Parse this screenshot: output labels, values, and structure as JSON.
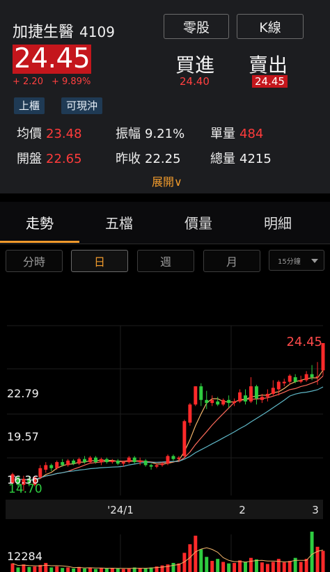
{
  "stock": {
    "name": "加捷生醫",
    "code": "4109",
    "price": "24.45",
    "change": "+ 2.20",
    "change_pct": "+ 9.89%",
    "tags": [
      "上櫃",
      "可現沖"
    ]
  },
  "top_buttons": {
    "odd_lot": "零股",
    "kline": "K線"
  },
  "quote": {
    "buy_label": "買進",
    "buy_value": "24.40",
    "sell_label": "賣出",
    "sell_value": "24.45"
  },
  "stats": {
    "avg_label": "均價",
    "avg_value": "23.48",
    "amp_label": "振幅",
    "amp_value": "9.21%",
    "unit_vol_label": "單量",
    "unit_vol_value": "484",
    "open_label": "開盤",
    "open_value": "22.65",
    "prev_close_label": "昨收",
    "prev_close_value": "22.25",
    "total_vol_label": "總量",
    "total_vol_value": "4215"
  },
  "expand_label": "展開∨",
  "tabs": [
    "走勢",
    "五檔",
    "價量",
    "明細"
  ],
  "period_buttons": [
    "分時",
    "日",
    "週",
    "月"
  ],
  "interval_select": "15分鐘",
  "colors": {
    "up": "#ff2a2a",
    "down": "#2ecc40",
    "accent": "#f09a2c",
    "ma_orange": "#f3b46a",
    "ma_red": "#ff6b5b",
    "ma_cyan": "#5fb8c8"
  },
  "chart_data": {
    "type": "candlestick",
    "price_axis_labels": [
      "22.79",
      "19.57",
      "16.36"
    ],
    "max_label": "24.45",
    "min_label": "14.70",
    "x_tick_labels": [
      "'24/1",
      "2",
      "3"
    ],
    "volume_label": "12284",
    "ylim": [
      14.4,
      25.6
    ],
    "candles": [
      [
        15.2,
        15.8,
        15.0,
        15.9
      ],
      [
        15.6,
        15.1,
        14.9,
        15.7
      ],
      [
        15.1,
        15.5,
        14.7,
        15.7
      ],
      [
        15.5,
        15.2,
        15.0,
        15.7
      ],
      [
        15.1,
        15.6,
        15.0,
        15.7
      ],
      [
        15.6,
        16.2,
        15.5,
        16.4
      ],
      [
        16.1,
        16.4,
        15.9,
        16.6
      ],
      [
        16.4,
        16.2,
        16.0,
        16.5
      ],
      [
        16.2,
        16.6,
        16.1,
        16.7
      ],
      [
        16.6,
        16.4,
        16.3,
        16.8
      ],
      [
        16.4,
        16.7,
        16.3,
        16.8
      ],
      [
        16.7,
        16.5,
        16.4,
        16.8
      ],
      [
        16.5,
        16.8,
        16.4,
        16.9
      ],
      [
        16.8,
        16.6,
        16.5,
        17.0
      ],
      [
        16.6,
        16.9,
        16.5,
        17.0
      ],
      [
        16.9,
        16.6,
        16.5,
        17.0
      ],
      [
        16.6,
        16.8,
        16.4,
        16.9
      ],
      [
        16.8,
        16.6,
        16.5,
        16.9
      ],
      [
        16.6,
        16.7,
        16.5,
        16.8
      ],
      [
        16.7,
        16.5,
        16.4,
        16.8
      ],
      [
        16.5,
        16.6,
        16.3,
        16.7
      ],
      [
        16.6,
        16.9,
        16.5,
        17.0
      ],
      [
        16.9,
        16.6,
        16.5,
        17.0
      ],
      [
        16.6,
        16.7,
        16.4,
        16.9
      ],
      [
        16.7,
        16.4,
        16.3,
        16.8
      ],
      [
        16.4,
        16.3,
        16.1,
        16.5
      ],
      [
        16.3,
        16.4,
        16.2,
        16.5
      ],
      [
        16.4,
        16.5,
        16.3,
        16.6
      ],
      [
        16.5,
        17.0,
        16.4,
        17.1
      ],
      [
        17.0,
        16.8,
        16.7,
        17.1
      ],
      [
        16.8,
        16.9,
        16.6,
        17.0
      ],
      [
        17.0,
        19.3,
        16.9,
        19.4
      ],
      [
        19.2,
        20.4,
        19.0,
        20.5
      ],
      [
        20.4,
        21.6,
        20.3,
        21.6
      ],
      [
        21.6,
        20.7,
        20.3,
        21.8
      ],
      [
        20.7,
        20.5,
        20.1,
        21.3
      ],
      [
        20.5,
        20.7,
        20.3,
        21.0
      ],
      [
        20.6,
        20.4,
        20.3,
        20.9
      ],
      [
        20.4,
        20.7,
        20.3,
        20.8
      ],
      [
        20.7,
        20.5,
        20.2,
        21.0
      ],
      [
        20.5,
        20.6,
        20.3,
        20.8
      ],
      [
        20.6,
        21.2,
        20.5,
        21.4
      ],
      [
        21.0,
        20.6,
        20.4,
        21.4
      ],
      [
        20.6,
        21.6,
        20.5,
        22.2
      ],
      [
        21.6,
        20.8,
        20.4,
        21.7
      ],
      [
        20.7,
        20.9,
        20.5,
        21.1
      ],
      [
        20.9,
        21.1,
        20.6,
        21.4
      ],
      [
        21.1,
        21.5,
        21.0,
        22.0
      ],
      [
        21.4,
        21.9,
        21.0,
        22.0
      ],
      [
        21.8,
        21.9,
        21.6,
        22.1
      ],
      [
        21.9,
        22.3,
        21.7,
        22.4
      ],
      [
        22.2,
        21.9,
        21.8,
        22.4
      ],
      [
        21.9,
        22.0,
        21.8,
        22.3
      ],
      [
        22.0,
        22.4,
        21.9,
        22.6
      ],
      [
        22.4,
        22.2,
        22.0,
        23.0
      ],
      [
        22.2,
        22.25,
        21.7,
        23.2
      ],
      [
        22.65,
        24.45,
        22.3,
        24.45
      ]
    ],
    "volume": [
      1700,
      900,
      1500,
      1000,
      1100,
      1400,
      1800,
      900,
      1100,
      800,
      900,
      700,
      1000,
      700,
      900,
      600,
      800,
      700,
      800,
      700,
      600,
      700,
      900,
      800,
      700,
      900,
      1100,
      1300,
      1500,
      1800,
      1700,
      3800,
      5500,
      7200,
      4500,
      3000,
      2200,
      2600,
      2000,
      1700,
      1800,
      2300,
      2000,
      2800,
      2500,
      1900,
      1600,
      2000,
      2600,
      1900,
      2200,
      2800,
      2000,
      2600,
      8000,
      5000,
      4200
    ]
  }
}
